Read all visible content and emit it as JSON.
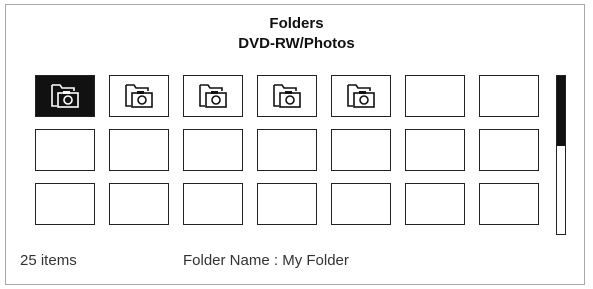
{
  "header": {
    "title": "Folders",
    "subtitle": "DVD-RW/Photos"
  },
  "grid": {
    "rows": 3,
    "columns": 7,
    "cells": [
      {
        "icon": "photo-folder-icon",
        "selected": true
      },
      {
        "icon": "photo-folder-icon",
        "selected": false
      },
      {
        "icon": "photo-folder-icon",
        "selected": false
      },
      {
        "icon": "photo-folder-icon",
        "selected": false
      },
      {
        "icon": "photo-folder-icon",
        "selected": false
      },
      {
        "icon": null,
        "selected": false
      },
      {
        "icon": null,
        "selected": false
      },
      {
        "icon": null,
        "selected": false
      },
      {
        "icon": null,
        "selected": false
      },
      {
        "icon": null,
        "selected": false
      },
      {
        "icon": null,
        "selected": false
      },
      {
        "icon": null,
        "selected": false
      },
      {
        "icon": null,
        "selected": false
      },
      {
        "icon": null,
        "selected": false
      },
      {
        "icon": null,
        "selected": false
      },
      {
        "icon": null,
        "selected": false
      },
      {
        "icon": null,
        "selected": false
      },
      {
        "icon": null,
        "selected": false
      },
      {
        "icon": null,
        "selected": false
      },
      {
        "icon": null,
        "selected": false
      },
      {
        "icon": null,
        "selected": false
      }
    ]
  },
  "scrollbar": {
    "position_fraction": 0.0,
    "visible_fraction": 0.44
  },
  "footer": {
    "item_count": "25 items",
    "folder_name": "Folder Name : My Folder"
  },
  "colors": {
    "selected_bg": "#111111",
    "border": "#222222",
    "frame": "#a9a9a9"
  }
}
